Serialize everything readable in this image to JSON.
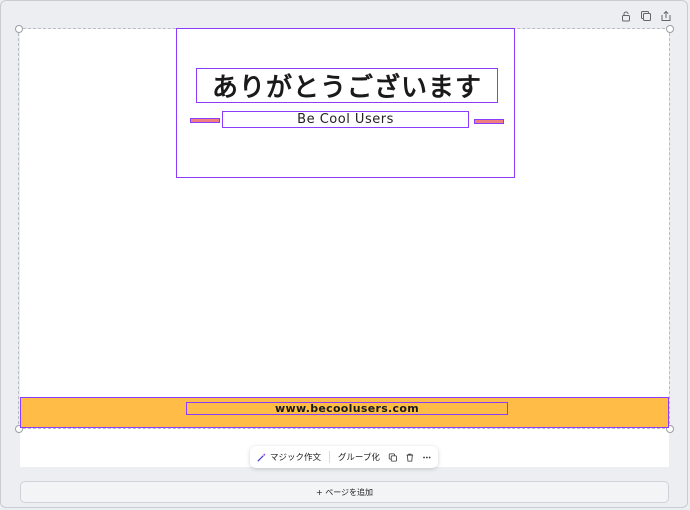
{
  "canvas": {
    "title": "ありがとうございます",
    "subtitle": "Be Cool Users",
    "url": "www.becoolusers.com"
  },
  "toolbar": {
    "magic_write_label": "マジック作文",
    "group_label": "グループ化",
    "icons": [
      "magic-wand-icon",
      "duplicate-icon",
      "trash-icon",
      "more-icon"
    ]
  },
  "top_icons": [
    "lock-icon",
    "duplicate-page-icon",
    "share-page-icon"
  ],
  "add_page_label": "+ ページを追加",
  "colors": {
    "selection": "#8b3dff",
    "footer_band": "#ffbd47",
    "deco_line": "#f08080",
    "background": "#eceef1"
  }
}
